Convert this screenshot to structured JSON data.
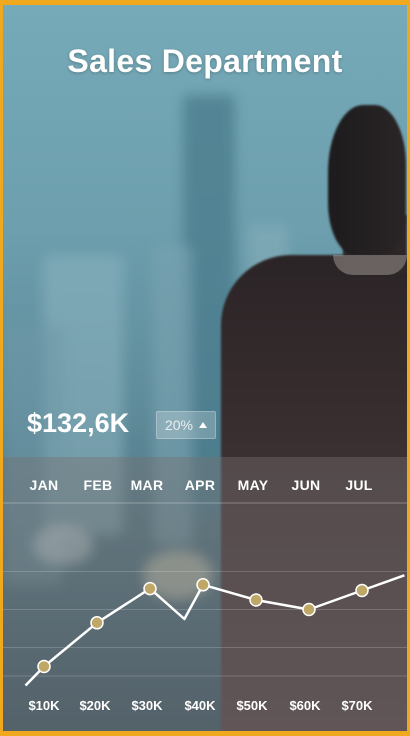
{
  "title": "Sales Department",
  "summary": {
    "total": "$132,6K",
    "change": "20%"
  },
  "colors": {
    "border": "#f0a81e",
    "line": "#ffffff",
    "point": "#bfa768"
  },
  "chart_data": {
    "type": "line",
    "months": [
      "JAN",
      "FEB",
      "MAR",
      "APR",
      "MAY",
      "JUN",
      "JUL"
    ],
    "value_labels": [
      "$10K",
      "$20K",
      "$30K",
      "$40K",
      "$50K",
      "$60K",
      "$70K"
    ],
    "series": [
      {
        "values": [
          0.5,
          1.5,
          3.8,
          5.6,
          4.0,
          5.8,
          5.0,
          4.5,
          5.5,
          6.3
        ],
        "x": [
          0.15,
          0.5,
          1.5,
          2.5,
          3.15,
          3.5,
          4.5,
          5.5,
          6.5,
          7.3
        ],
        "marker_points": [
          1,
          2,
          3,
          5,
          6,
          7,
          8
        ]
      }
    ],
    "ylim": [
      0,
      10
    ],
    "grid": true
  }
}
